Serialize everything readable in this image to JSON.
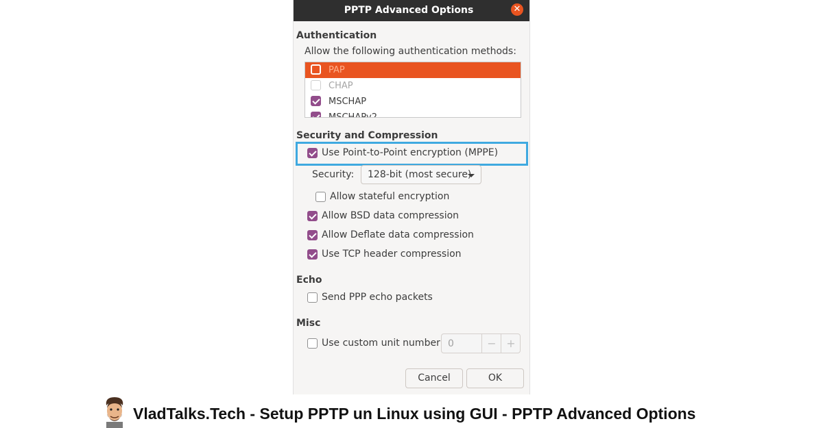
{
  "dialog": {
    "title": "PPTP Advanced Options",
    "close_icon": "close-icon"
  },
  "authentication": {
    "heading": "Authentication",
    "prompt": "Allow the following authentication methods:",
    "methods": [
      {
        "label": "PAP",
        "checked": false,
        "selected": true
      },
      {
        "label": "CHAP",
        "checked": false,
        "enabled": false
      },
      {
        "label": "MSCHAP",
        "checked": true
      },
      {
        "label": "MSCHAPv2",
        "checked": true
      }
    ]
  },
  "security": {
    "heading": "Security and Compression",
    "mppe_label": "Use Point-to-Point encryption (MPPE)",
    "security_label": "Security:",
    "security_value": "128-bit (most secure)",
    "stateful_label": "Allow stateful encryption",
    "bsd_label": "Allow BSD data compression",
    "deflate_label": "Allow Deflate data compression",
    "tcp_label": "Use TCP header compression"
  },
  "echo": {
    "heading": "Echo",
    "send_label": "Send PPP echo packets"
  },
  "misc": {
    "heading": "Misc",
    "unit_label": "Use custom unit number:",
    "unit_value": "0",
    "minus": "−",
    "plus": "+"
  },
  "buttons": {
    "cancel": "Cancel",
    "ok": "OK"
  },
  "caption": "VladTalks.Tech - Setup PPTP un Linux using GUI - PPTP Advanced Options",
  "colors": {
    "accent": "#e95420",
    "check": "#924d8b",
    "highlight": "#3fa9e0"
  }
}
